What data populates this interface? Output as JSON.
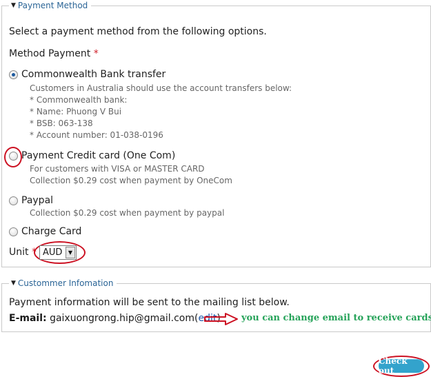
{
  "payment_section": {
    "legend": "Payment Method",
    "intro": "Select a payment method from the following options.",
    "method_label": "Method Payment",
    "required_mark": "*",
    "options": [
      {
        "label": "Commonwealth Bank transfer",
        "checked": true,
        "details": [
          "Customers in Australia should use the account transfers below:",
          "* Commonwealth bank:",
          "* Name: Phuong V Bui",
          "* BSB: 063-138",
          "* Account number: 01-038-0196"
        ]
      },
      {
        "label": "Payment Credit card (One Com)",
        "checked": false,
        "details": [
          "For customers with VISA or MASTER CARD",
          "Collection $0.29 cost when payment by OneCom"
        ]
      },
      {
        "label": "Paypal",
        "checked": false,
        "details": [
          "Collection $0.29 cost when payment by paypal"
        ]
      },
      {
        "label": "Charge Card",
        "checked": false,
        "details": []
      }
    ],
    "unit_label": "Unit",
    "unit_value": "AUD"
  },
  "customer_section": {
    "legend": "Custommer Infomation",
    "info_text": "Payment information will be sent to the mailing list below.",
    "email_label": "E-mail:",
    "email_value": "gaixuongrong.hip@gmail.com",
    "edit_open": "(",
    "edit_link": "edit",
    "edit_close": ")",
    "annotation": "you can change email to receive cards"
  },
  "checkout_label": "Check out",
  "colors": {
    "annotation_red": "#cc1122",
    "annotation_green": "#27a35a",
    "link_blue": "#1c56a8",
    "checkout_blue": "#33a3cc"
  }
}
